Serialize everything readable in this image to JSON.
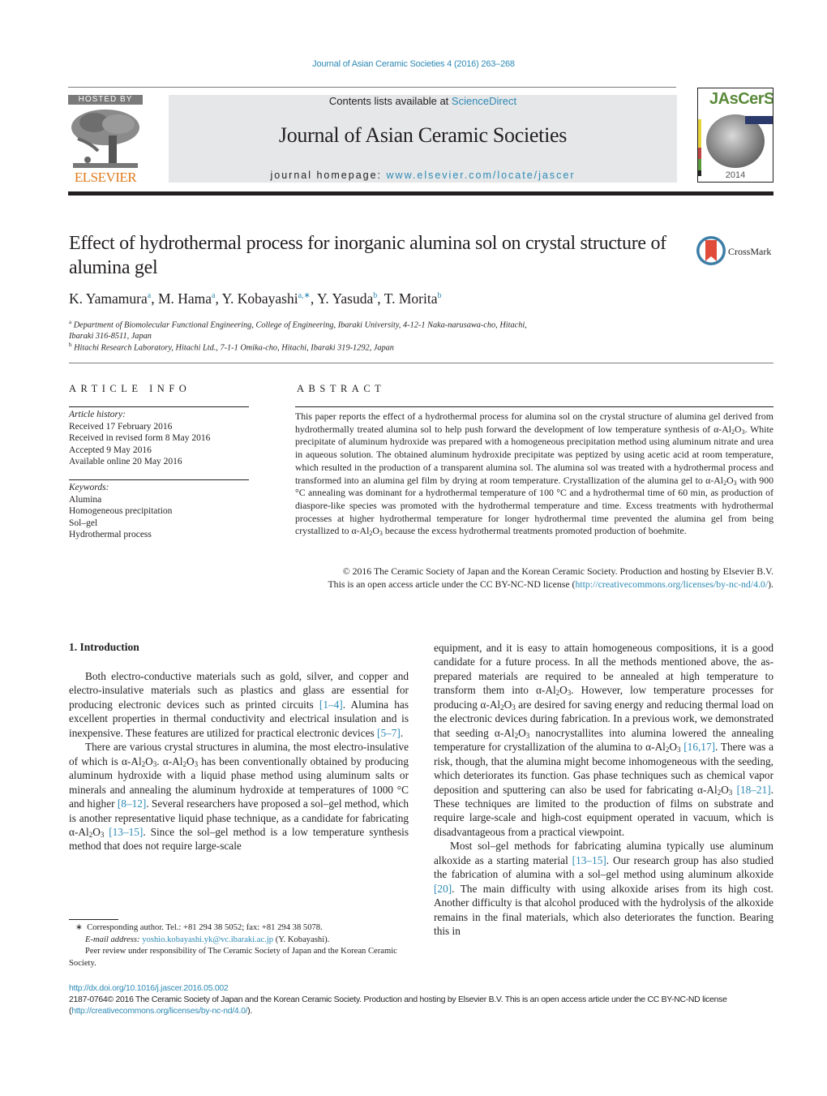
{
  "header": {
    "journal_citation": "Journal of Asian Ceramic Societies 4 (2016) 263–268",
    "hosted_by": "HOSTED BY",
    "publisher_logo": "ELSEVIER",
    "contents_prefix": "Contents lists available at ",
    "contents_link": "ScienceDirect",
    "journal_name": "Journal of Asian Ceramic Societies",
    "homepage_prefix": "journal homepage: ",
    "homepage_link": "www.elsevier.com/locate/jascer",
    "cover_title": "JAsCerS",
    "cover_year": "2014"
  },
  "article": {
    "title": "Effect of hydrothermal process for inorganic alumina sol on crystal structure of alumina gel",
    "crossmark_label": "CrossMark",
    "authors": [
      {
        "name": "K. Yamamura",
        "sup": "a"
      },
      {
        "name": "M. Hama",
        "sup": "a"
      },
      {
        "name": "Y. Kobayashi",
        "sup": "a,∗"
      },
      {
        "name": "Y. Yasuda",
        "sup": "b"
      },
      {
        "name": "T. Morita",
        "sup": "b"
      }
    ],
    "affiliations": [
      {
        "sup": "a",
        "text": "Department of Biomolecular Functional Engineering, College of Engineering, Ibaraki University, 4-12-1 Naka-narusawa-cho, Hitachi,",
        "text2": "Ibaraki 316-8511, Japan"
      },
      {
        "sup": "b",
        "text": "Hitachi Research Laboratory, Hitachi Ltd., 7-1-1 Omika-cho, Hitachi, Ibaraki 319-1292, Japan"
      }
    ]
  },
  "article_info": {
    "heading": "ARTICLE INFO",
    "history_label": "Article history:",
    "history": [
      "Received 17 February 2016",
      "Received in revised form 8 May 2016",
      "Accepted 9 May 2016",
      "Available online 20 May 2016"
    ],
    "keywords_label": "Keywords:",
    "keywords": [
      "Alumina",
      "Homogeneous precipitation",
      "Sol–gel",
      "Hydrothermal process"
    ]
  },
  "abstract": {
    "heading": "ABSTRACT",
    "p1": "This paper reports the effect of a hydrothermal process for alumina sol on the crystal structure of alumina gel derived from hydrothermally treated alumina sol to help push forward the development of low temperature synthesis of ",
    "p2": ". White precipitate of aluminum hydroxide was prepared with a homogeneous precipitation method using aluminum nitrate and urea in aqueous solution. The obtained aluminum hydroxide precipitate was peptized by using acetic acid at room temperature, which resulted in the production of a transparent alumina sol. The alumina sol was treated with a hydrothermal process and transformed into an alumina gel film by drying at room temperature. Crystallization of the alumina gel to ",
    "p3": " with 900 °C annealing was dominant for a hydrothermal temperature of 100 °C and a hydrothermal time of 60 min, as production of diaspore-like species was promoted with the hydrothermal temperature and time. Excess treatments with hydrothermal processes at higher hydrothermal temperature for longer hydrothermal time prevented the alumina gel from being crystallized to ",
    "p4": " because the excess hydrothermal treatments promoted production of boehmite.",
    "copyright": "© 2016 The Ceramic Society of Japan and the Korean Ceramic Society. Production and hosting by Elsevier B.V. This is an open access article under the CC BY-NC-ND license (",
    "license_link": "http://creativecommons.org/licenses/by-nc-nd/4.0/",
    "copyright_end": ")."
  },
  "formula": {
    "prefix": "α-Al",
    "sub1": "2",
    "mid": "O",
    "sub2": "3"
  },
  "introduction": {
    "heading": "1.  Introduction",
    "left": {
      "p1a": "Both electro-conductive materials such as gold, silver, and copper and electro-insulative materials such as plastics and glass are essential for producing electronic devices such as printed circuits ",
      "ref1": "[1–4]",
      "p1b": ". Alumina has excellent properties in thermal conductivity and electrical insulation and is inexpensive. These features are utilized for practical electronic devices ",
      "ref2": "[5–7]",
      "p1c": ".",
      "p2a": "There are various crystal structures in alumina, the most electro-insulative of which is ",
      "p2b": ". ",
      "p2c": " has been conventionally obtained by producing aluminum hydroxide with a liquid phase method using aluminum salts or minerals and annealing the aluminum hydroxide at temperatures of 1000 °C and higher ",
      "ref3": "[8–12]",
      "p2d": ". Several researchers have proposed a sol–gel method, which is another representative liquid phase technique, as a candidate for fabricating ",
      "ref4": "[13–15]",
      "p2e": ". Since the sol–gel method is a low temperature synthesis method that does not require large-scale"
    },
    "right": {
      "p1a": "equipment, and it is easy to attain homogeneous compositions, it is a good candidate for a future process. In all the methods mentioned above, the as-prepared materials are required to be annealed at high temperature to transform them into ",
      "p1b": ". However, low temperature processes for producing ",
      "p1c": " are desired for saving energy and reducing thermal load on the electronic devices during fabrication. In a previous work, we demonstrated that seeding ",
      "p1d": " nanocrystallites into alumina lowered the annealing temperature for crystallization of the alumina to ",
      "ref1": "[16,17]",
      "p1e": ". There was a risk, though, that the alumina might become inhomogeneous with the seeding, which deteriorates its function. Gas phase techniques such as chemical vapor deposition and sputtering can also be used for fabricating ",
      "ref2": "[18–21]",
      "p1f": ". These techniques are limited to the production of films on substrate and require large-scale and high-cost equipment operated in vacuum, which is disadvantageous from a practical viewpoint.",
      "p2a": "Most sol–gel methods for fabricating alumina typically use aluminum alkoxide as a starting material ",
      "ref3": "[13–15]",
      "p2b": ". Our research group has also studied the fabrication of alumina with a sol–gel method using aluminum alkoxide ",
      "ref4": "[20]",
      "p2c": ". The main difficulty with using alkoxide arises from its high cost. Another difficulty is that alcohol produced with the hydrolysis of the alkoxide remains in the final materials, which also deteriorates the function. Bearing this in"
    }
  },
  "footnotes": {
    "star": "∗",
    "corresponding": "Corresponding author. Tel.: +81 294 38 5052; fax: +81 294 38 5078.",
    "email_label": "E-mail address:",
    "email": "yoshio.kobayashi.yk@vc.ibaraki.ac.jp",
    "email_suffix": " (Y. Kobayashi).",
    "peer_review": "Peer review under responsibility of The Ceramic Society of Japan and the Korean Ceramic Society."
  },
  "bottom": {
    "doi": "http://dx.doi.org/10.1016/j.jascer.2016.05.002",
    "issn_line": "2187-0764© 2016 The Ceramic Society of Japan and the Korean Ceramic Society. Production and hosting by Elsevier B.V. This is an open access article under the CC BY-NC-ND license (",
    "license_link": "http://creativecommons.org/licenses/by-nc-nd/4.0/",
    "end": ")."
  }
}
